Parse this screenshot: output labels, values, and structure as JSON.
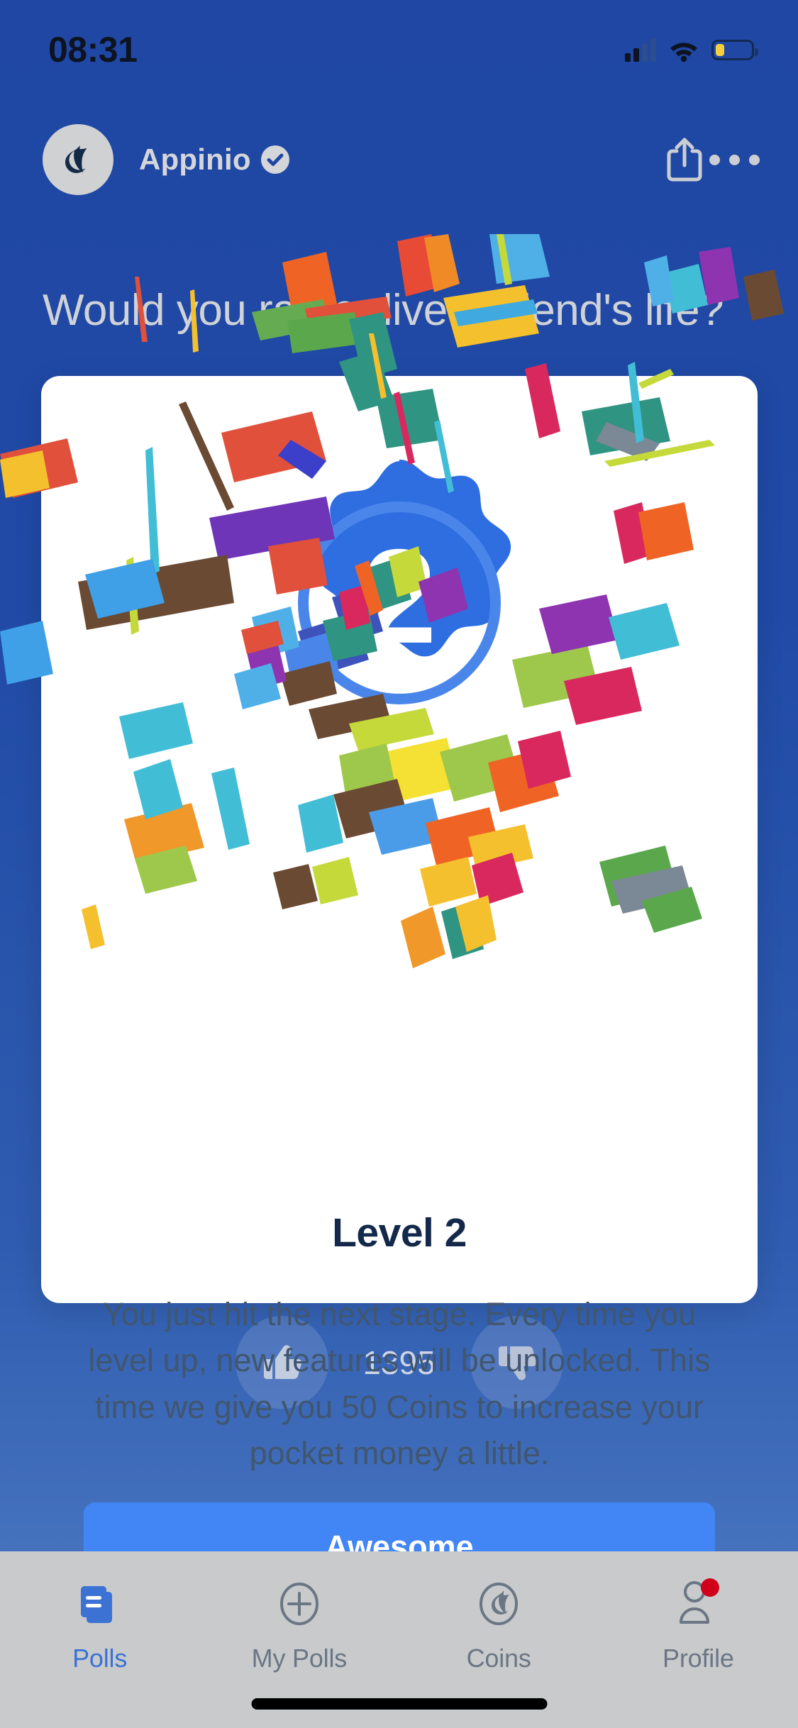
{
  "status_bar": {
    "time": "08:31",
    "signal_icon": "cellular-signal-icon",
    "wifi_icon": "wifi-icon",
    "battery_icon": "battery-low-icon",
    "battery_level_pct": 26
  },
  "header": {
    "avatar_icon": "appinio-logo-avatar",
    "account_name": "Appinio",
    "verified_icon": "verified-check-icon",
    "share_icon": "share-icon",
    "more_icon": "more-options-icon"
  },
  "poll": {
    "question": "Would you rather live a friend's life?",
    "like_icon": "thumbs-up-icon",
    "dislike_icon": "thumbs-down-icon",
    "like_count": "1395"
  },
  "modal": {
    "badge_icon": "level-badge-icon",
    "badge_number": "2",
    "title": "Level 2",
    "body": "You just hit the next stage. Every time you level up, new features will be unlocked. This time we give you 50 Coins to increase your pocket money a little.",
    "cta_label": "Awesome"
  },
  "tabbar": {
    "items": [
      {
        "label": "Polls",
        "icon": "polls-stacked-cards-icon",
        "active": true
      },
      {
        "label": "My Polls",
        "icon": "plus-circle-icon",
        "active": false
      },
      {
        "label": "Coins",
        "icon": "appinio-coin-icon",
        "active": false
      },
      {
        "label": "Profile",
        "icon": "person-icon",
        "active": false
      }
    ]
  },
  "colors": {
    "background_blue": "#1f47a3",
    "cta_blue": "#4285f4",
    "title_navy": "#13284b",
    "body_slate": "#41566f",
    "tabbar_gray": "#c8cacc",
    "tab_active_blue": "#3b72d4",
    "badge_blue": "#2f6ee0",
    "notification_red": "#d0021b",
    "battery_yellow": "#f5cf3d"
  }
}
